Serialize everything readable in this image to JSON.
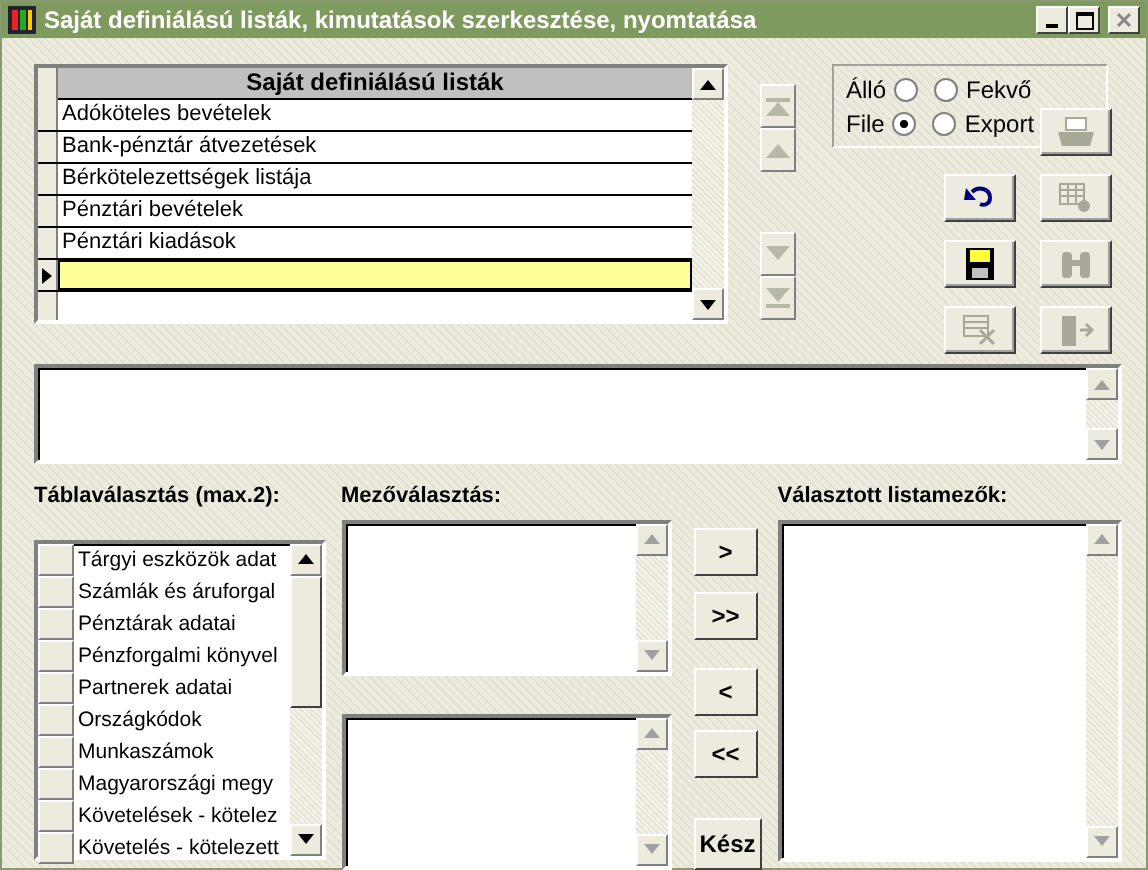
{
  "window": {
    "title": "Saját definiálású listák, kimutatások szerkesztése, nyomtatása"
  },
  "list_grid": {
    "header": "Saját definiálású listák",
    "rows": [
      {
        "text": "Adóköteles bevételek",
        "selected": false
      },
      {
        "text": "Bank-pénztár átvezetések",
        "selected": false
      },
      {
        "text": "Bérkötelezettségek listája",
        "selected": false
      },
      {
        "text": "Pénztári bevételek",
        "selected": false
      },
      {
        "text": "Pénztári kiadások",
        "selected": false
      }
    ],
    "new_record": {
      "selected": true
    }
  },
  "navigation_buttons": [
    {
      "kind": "first",
      "disabled": true
    },
    {
      "kind": "previous",
      "disabled": true
    },
    {
      "kind": "next",
      "disabled": true
    },
    {
      "kind": "last",
      "disabled": true
    }
  ],
  "orientation": [
    {
      "label": "Álló",
      "selected": false
    },
    {
      "label": "Fekvő",
      "selected": false
    }
  ],
  "output": [
    {
      "label": "File",
      "selected": true
    },
    {
      "label": "Export",
      "selected": false
    }
  ],
  "tool_buttons": [
    {
      "kind": "print",
      "disabled": true
    },
    {
      "kind": "undo",
      "disabled": false
    },
    {
      "kind": "grid-search",
      "disabled": true
    },
    {
      "kind": "save",
      "disabled": false
    },
    {
      "kind": "binoculars",
      "disabled": true
    },
    {
      "kind": "delete",
      "disabled": true
    },
    {
      "kind": "exit",
      "disabled": true
    }
  ],
  "table_selection": {
    "label": "Táblaválasztás (max.2):",
    "items": [
      {
        "text": "Tárgyi eszközök adat",
        "checked": false
      },
      {
        "text": "Számlák és áruforgal",
        "checked": false
      },
      {
        "text": "Pénztárak adatai",
        "checked": false
      },
      {
        "text": "Pénzforgalmi könyvel",
        "checked": false
      },
      {
        "text": "Partnerek adatai",
        "checked": false
      },
      {
        "text": "Országkódok",
        "checked": false
      },
      {
        "text": "Munkaszámok",
        "checked": false
      },
      {
        "text": "Magyarországi megy",
        "checked": false
      },
      {
        "text": "Követelések - kötelez",
        "checked": false
      },
      {
        "text": "Követelés - kötelezett",
        "checked": false
      }
    ]
  },
  "field_selection": {
    "label": "Mezőválasztás:"
  },
  "move_buttons": [
    ">",
    ">>",
    "<",
    "<<",
    "Kész"
  ],
  "selected_fields": {
    "label": "Választott listamezők:"
  }
}
